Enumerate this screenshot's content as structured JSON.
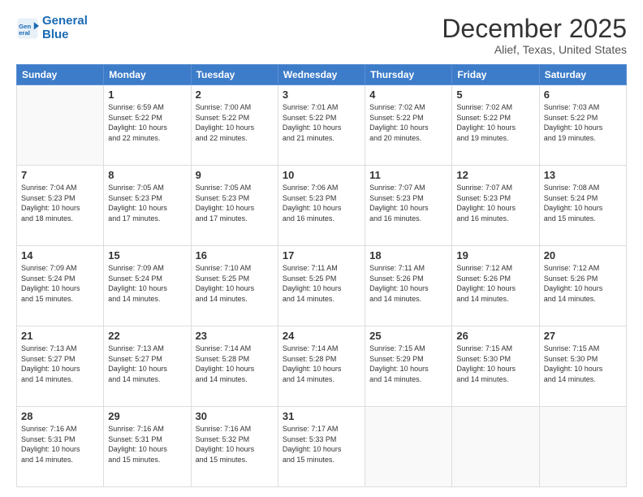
{
  "header": {
    "logo_line1": "General",
    "logo_line2": "Blue",
    "main_title": "December 2025",
    "subtitle": "Alief, Texas, United States"
  },
  "weekdays": [
    "Sunday",
    "Monday",
    "Tuesday",
    "Wednesday",
    "Thursday",
    "Friday",
    "Saturday"
  ],
  "weeks": [
    [
      {
        "day": "",
        "info": ""
      },
      {
        "day": "1",
        "info": "Sunrise: 6:59 AM\nSunset: 5:22 PM\nDaylight: 10 hours\nand 22 minutes."
      },
      {
        "day": "2",
        "info": "Sunrise: 7:00 AM\nSunset: 5:22 PM\nDaylight: 10 hours\nand 22 minutes."
      },
      {
        "day": "3",
        "info": "Sunrise: 7:01 AM\nSunset: 5:22 PM\nDaylight: 10 hours\nand 21 minutes."
      },
      {
        "day": "4",
        "info": "Sunrise: 7:02 AM\nSunset: 5:22 PM\nDaylight: 10 hours\nand 20 minutes."
      },
      {
        "day": "5",
        "info": "Sunrise: 7:02 AM\nSunset: 5:22 PM\nDaylight: 10 hours\nand 19 minutes."
      },
      {
        "day": "6",
        "info": "Sunrise: 7:03 AM\nSunset: 5:22 PM\nDaylight: 10 hours\nand 19 minutes."
      }
    ],
    [
      {
        "day": "7",
        "info": "Sunrise: 7:04 AM\nSunset: 5:23 PM\nDaylight: 10 hours\nand 18 minutes."
      },
      {
        "day": "8",
        "info": "Sunrise: 7:05 AM\nSunset: 5:23 PM\nDaylight: 10 hours\nand 17 minutes."
      },
      {
        "day": "9",
        "info": "Sunrise: 7:05 AM\nSunset: 5:23 PM\nDaylight: 10 hours\nand 17 minutes."
      },
      {
        "day": "10",
        "info": "Sunrise: 7:06 AM\nSunset: 5:23 PM\nDaylight: 10 hours\nand 16 minutes."
      },
      {
        "day": "11",
        "info": "Sunrise: 7:07 AM\nSunset: 5:23 PM\nDaylight: 10 hours\nand 16 minutes."
      },
      {
        "day": "12",
        "info": "Sunrise: 7:07 AM\nSunset: 5:23 PM\nDaylight: 10 hours\nand 16 minutes."
      },
      {
        "day": "13",
        "info": "Sunrise: 7:08 AM\nSunset: 5:24 PM\nDaylight: 10 hours\nand 15 minutes."
      }
    ],
    [
      {
        "day": "14",
        "info": "Sunrise: 7:09 AM\nSunset: 5:24 PM\nDaylight: 10 hours\nand 15 minutes."
      },
      {
        "day": "15",
        "info": "Sunrise: 7:09 AM\nSunset: 5:24 PM\nDaylight: 10 hours\nand 14 minutes."
      },
      {
        "day": "16",
        "info": "Sunrise: 7:10 AM\nSunset: 5:25 PM\nDaylight: 10 hours\nand 14 minutes."
      },
      {
        "day": "17",
        "info": "Sunrise: 7:11 AM\nSunset: 5:25 PM\nDaylight: 10 hours\nand 14 minutes."
      },
      {
        "day": "18",
        "info": "Sunrise: 7:11 AM\nSunset: 5:26 PM\nDaylight: 10 hours\nand 14 minutes."
      },
      {
        "day": "19",
        "info": "Sunrise: 7:12 AM\nSunset: 5:26 PM\nDaylight: 10 hours\nand 14 minutes."
      },
      {
        "day": "20",
        "info": "Sunrise: 7:12 AM\nSunset: 5:26 PM\nDaylight: 10 hours\nand 14 minutes."
      }
    ],
    [
      {
        "day": "21",
        "info": "Sunrise: 7:13 AM\nSunset: 5:27 PM\nDaylight: 10 hours\nand 14 minutes."
      },
      {
        "day": "22",
        "info": "Sunrise: 7:13 AM\nSunset: 5:27 PM\nDaylight: 10 hours\nand 14 minutes."
      },
      {
        "day": "23",
        "info": "Sunrise: 7:14 AM\nSunset: 5:28 PM\nDaylight: 10 hours\nand 14 minutes."
      },
      {
        "day": "24",
        "info": "Sunrise: 7:14 AM\nSunset: 5:28 PM\nDaylight: 10 hours\nand 14 minutes."
      },
      {
        "day": "25",
        "info": "Sunrise: 7:15 AM\nSunset: 5:29 PM\nDaylight: 10 hours\nand 14 minutes."
      },
      {
        "day": "26",
        "info": "Sunrise: 7:15 AM\nSunset: 5:30 PM\nDaylight: 10 hours\nand 14 minutes."
      },
      {
        "day": "27",
        "info": "Sunrise: 7:15 AM\nSunset: 5:30 PM\nDaylight: 10 hours\nand 14 minutes."
      }
    ],
    [
      {
        "day": "28",
        "info": "Sunrise: 7:16 AM\nSunset: 5:31 PM\nDaylight: 10 hours\nand 14 minutes."
      },
      {
        "day": "29",
        "info": "Sunrise: 7:16 AM\nSunset: 5:31 PM\nDaylight: 10 hours\nand 15 minutes."
      },
      {
        "day": "30",
        "info": "Sunrise: 7:16 AM\nSunset: 5:32 PM\nDaylight: 10 hours\nand 15 minutes."
      },
      {
        "day": "31",
        "info": "Sunrise: 7:17 AM\nSunset: 5:33 PM\nDaylight: 10 hours\nand 15 minutes."
      },
      {
        "day": "",
        "info": ""
      },
      {
        "day": "",
        "info": ""
      },
      {
        "day": "",
        "info": ""
      }
    ]
  ]
}
